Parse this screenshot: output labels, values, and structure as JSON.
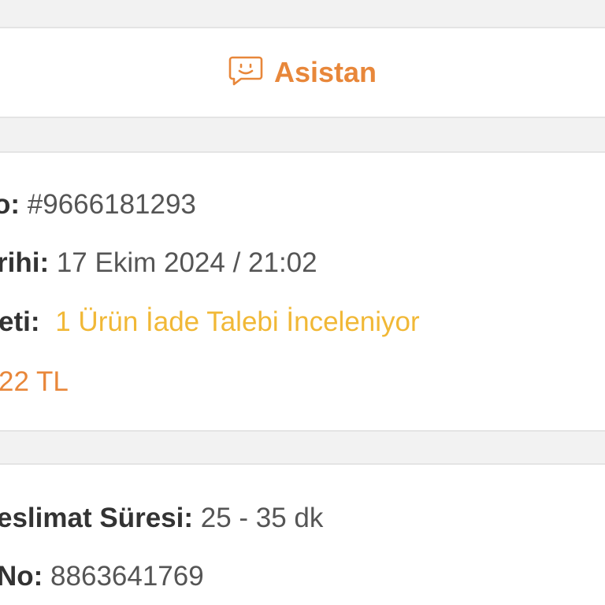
{
  "assistant": {
    "label": "Asistan",
    "icon": "chat-smile-icon",
    "color": "#e8873a"
  },
  "order": {
    "order_no_label": "o:",
    "order_no": "#9666181293",
    "date_label": "rihi:",
    "date": "17 Ekim 2024 / 21:02",
    "status_label": "eti:",
    "status": "1 Ürün İade Talebi İnceleniyor",
    "status_color": "#f1b836",
    "total": "22 TL",
    "total_color": "#e8873a"
  },
  "delivery": {
    "duration_label": "eslimat Süresi:",
    "duration": "25 - 35 dk",
    "number_label": "No:",
    "number": "8863641769"
  }
}
